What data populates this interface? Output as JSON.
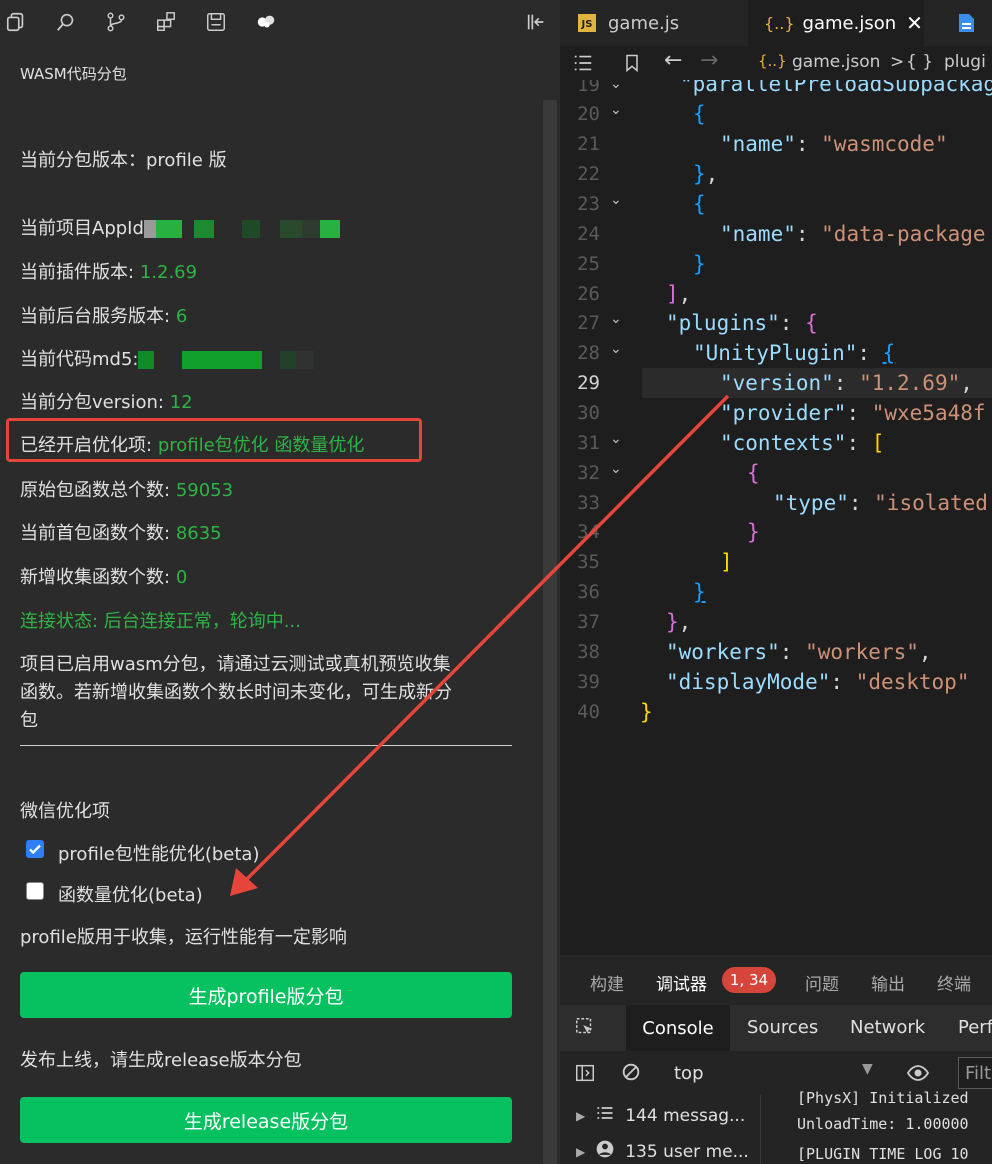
{
  "left_panel": {
    "title": "WASM代码分包",
    "subpackage_version_label": "当前分包版本：profile 版",
    "appid_label": "当前项目AppId",
    "plugin_version_label": "当前插件版本:",
    "plugin_version_value": "1.2.69",
    "backend_version_label": "当前后台服务版本:",
    "backend_version_value": "6",
    "md5_label": "当前代码md5:",
    "pkg_version_label": "当前分包version:",
    "pkg_version_value": "12",
    "enabled_opts_label": "已经开启优化项:",
    "enabled_opts_value": "profile包优化 函数量优化",
    "orig_func_label": "原始包函数总个数:",
    "orig_func_value": "59053",
    "first_pkg_func_label": "当前首包函数个数:",
    "first_pkg_func_value": "8635",
    "new_func_label": "新增收集函数个数:",
    "new_func_value": "0",
    "connection_status": "连接状态: 后台连接正常，轮询中...",
    "info_line1": "项目已启用wasm分包，请通过云测试或真机预览收集",
    "info_line2": "函数。若新增收集函数个数长时间未变化，可生成新分",
    "info_line3": "包",
    "wechat_opts_title": "微信优化项",
    "opt_profile_label": "profile包性能优化(beta)",
    "opt_profile_checked": true,
    "opt_funcnum_label": "函数量优化(beta)",
    "opt_funcnum_checked": false,
    "profile_note": "profile版用于收集，运行性能有一定影响",
    "gen_profile_button": "生成profile版分包",
    "release_note": "发布上线，请生成release版本分包",
    "gen_release_button": "生成release版分包"
  },
  "editor": {
    "tabs": [
      {
        "icon": "JS",
        "label": "game.js"
      },
      {
        "icon": "{..}",
        "label": "game.json"
      }
    ],
    "breadcrumb": {
      "file_icon": "{..}",
      "file": "game.json",
      "sep": ">",
      "obj_icon": "{ }",
      "node": "plugi"
    },
    "line_numbers": [
      "19",
      "20",
      "21",
      "22",
      "23",
      "24",
      "25",
      "26",
      "27",
      "28",
      "29",
      "30",
      "31",
      "32",
      "33",
      "34",
      "35",
      "36",
      "37",
      "38",
      "39",
      "40"
    ],
    "current_line": "29",
    "code": {
      "l19": "\"parallelPreloadSubpackag",
      "l21_key": "\"name\"",
      "l21_val": "\"wasmcode\"",
      "l24_key": "\"name\"",
      "l24_val": "\"data-package",
      "l27_key": "\"plugins\"",
      "l28_key": "\"UnityPlugin\"",
      "l29_key": "\"version\"",
      "l29_val": "\"1.2.69\"",
      "l30_key": "\"provider\"",
      "l30_val": "\"wxe5a48f",
      "l31_key": "\"contexts\"",
      "l33_key": "\"type\"",
      "l33_val": "\"isolated",
      "l38_key": "\"workers\"",
      "l38_val": "\"workers\"",
      "l39_key": "\"displayMode\"",
      "l39_val": "\"desktop\""
    }
  },
  "bottom_panel": {
    "tabs": [
      "构建",
      "调试器",
      "问题",
      "输出",
      "终端"
    ],
    "debugger_badge": "1, 34",
    "devtools_tabs": [
      "Console",
      "Sources",
      "Network",
      "Perfo"
    ],
    "context": "top",
    "filter_placeholder": "Filt",
    "messages_label": "144 messag...",
    "user_messages_label": "135 user me...",
    "log_lines": [
      "[PhysX] Initialized",
      "UnloadTime: 1.00000",
      "[PLUGIN TIME LOG 10"
    ]
  },
  "colors": {
    "green_value": "#2fb344",
    "button_green": "#07c160",
    "highlight_red": "#e5453b",
    "json_key": "#9cdcfe",
    "json_string": "#ce9178"
  }
}
